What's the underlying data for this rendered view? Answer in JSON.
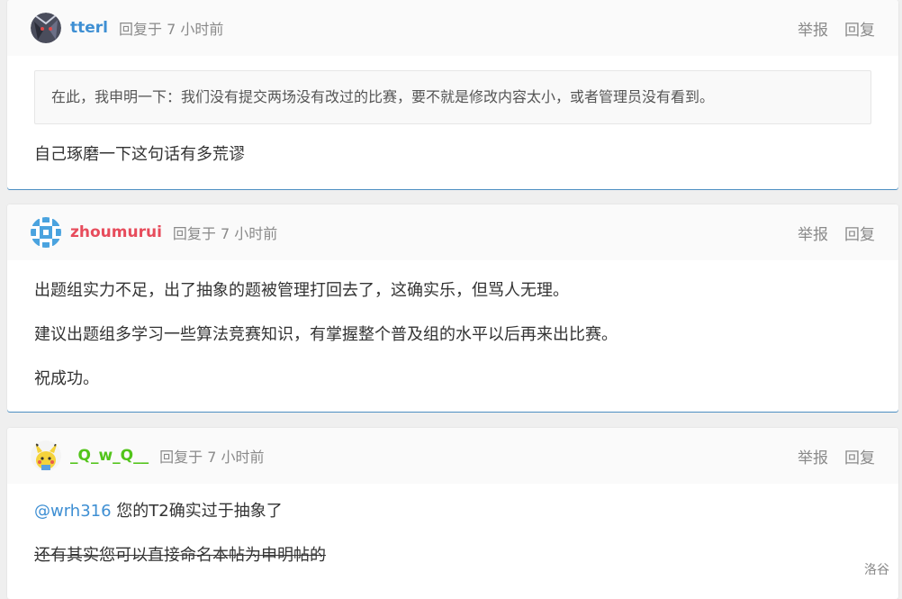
{
  "posts": [
    {
      "username": "tterl",
      "username_color": "#3e8fd3",
      "meta": "回复于 7 小时前",
      "report": "举报",
      "reply": "回复",
      "quote": "在此，我申明一下：我们没有提交两场没有改过的比赛，要不就是修改内容太小，或者管理员没有看到。",
      "paragraphs": [
        "自己琢磨一下这句话有多荒谬"
      ]
    },
    {
      "username": "zhoumurui",
      "username_color": "#e74c5c",
      "meta": "回复于 7 小时前",
      "report": "举报",
      "reply": "回复",
      "paragraphs": [
        "出题组实力不足，出了抽象的题被管理打回去了，这确实乐，但骂人无理。",
        "建议出题组多学习一些算法竞赛知识，有掌握整个普及组的水平以后再来出比赛。",
        "祝成功。"
      ]
    },
    {
      "username": "_Q_w_Q__",
      "username_color": "#52c41a",
      "meta": "回复于 7 小时前",
      "report": "举报",
      "reply": "回复",
      "mention": "@wrh316",
      "mention_rest": " 您的T2确实过于抽象了",
      "strike_text": "还有其实您可以直接命名本帖为申明帖的"
    }
  ],
  "watermark": "洛谷"
}
